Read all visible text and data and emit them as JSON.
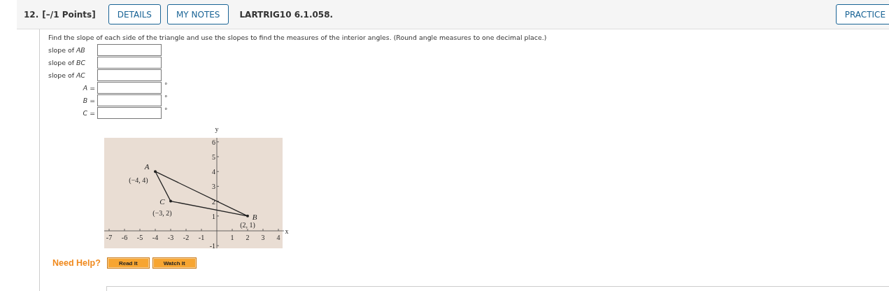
{
  "header": {
    "number": "12.",
    "points": "[–/1 Points]",
    "buttons": [
      "DETAILS",
      "MY NOTES"
    ],
    "code": "LARTRIG10 6.1.058.",
    "practice": "PRACTICE"
  },
  "question": "Find the slope of each side of the triangle and use the slopes to find the measures of the interior angles. (Round angle measures to one decimal place.)",
  "answers": [
    {
      "kind": "slope",
      "label": "slope of *AB*"
    },
    {
      "kind": "slope",
      "label": "slope of *BC*"
    },
    {
      "kind": "slope",
      "label": "slope of *AC*"
    },
    {
      "kind": "angle",
      "label": "*A* =",
      "unit": "°"
    },
    {
      "kind": "angle",
      "label": "*B* =",
      "unit": "°"
    },
    {
      "kind": "angle",
      "label": "*C* =",
      "unit": "°"
    }
  ],
  "figure": {
    "x_axis_label": "x",
    "y_axis_label": "y",
    "x_ticks": [
      "-7",
      "-6",
      "-5",
      "-4",
      "-3",
      "-2",
      "-1",
      "1",
      "2",
      "3",
      "4"
    ],
    "y_ticks": [
      "6",
      "5",
      "4",
      "3",
      "2",
      "1",
      "-1"
    ],
    "points": [
      {
        "name": "A",
        "coords": "(−4, 4)"
      },
      {
        "name": "B",
        "coords": "(2, 1)"
      },
      {
        "name": "C",
        "coords": "(−3, 2)"
      }
    ]
  },
  "help": {
    "label": "Need Help?",
    "buttons": [
      "Read It",
      "Watch It"
    ]
  }
}
